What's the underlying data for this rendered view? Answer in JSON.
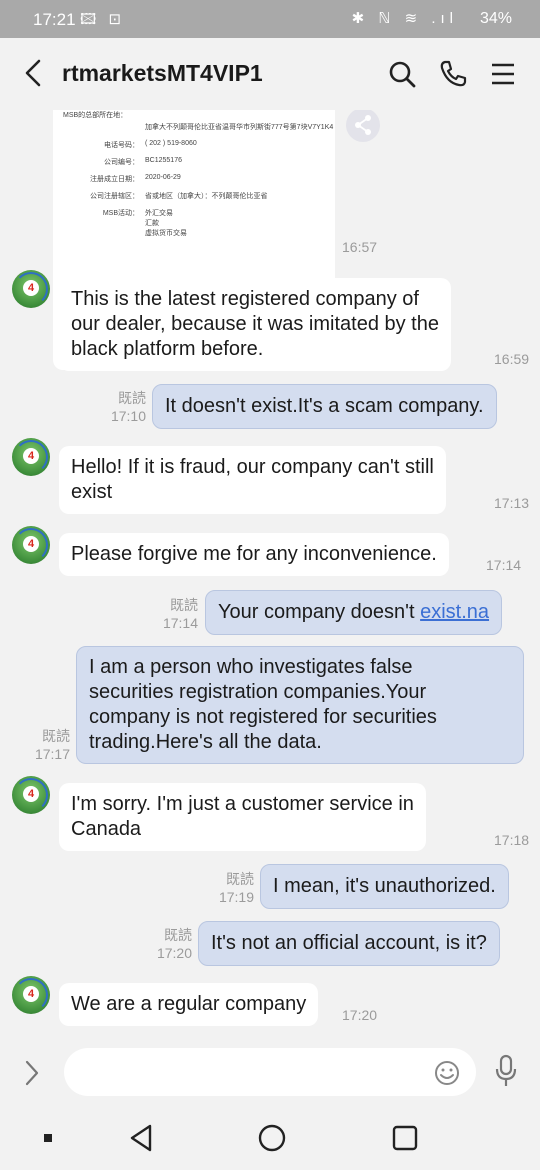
{
  "status_bar": {
    "time": "17:21",
    "left_icons": "🖾 ⊡",
    "right_icons": "✱ ℕ ≋ .ıl",
    "battery": "34%"
  },
  "header": {
    "title": "rtmarketsMT4VIP1",
    "icons": [
      "back-arrow-icon",
      "search-icon",
      "phone-icon",
      "menu-icon"
    ]
  },
  "image_message": {
    "rows": [
      {
        "key": "MSB的总部所在地：",
        "value": "加拿大不列颠哥伦比亚省温哥华市列斯街777号第7块V7Y1K4"
      },
      {
        "key": "电话号码：",
        "value": "( 202 ) 519-8060"
      },
      {
        "key": "公司编号：",
        "value": "BC1255176"
      },
      {
        "key": "注册成立日期：",
        "value": "2020-06-29"
      },
      {
        "key": "公司注册辖区：",
        "value": "省或地区（加拿大）：不列颠哥伦比亚省"
      },
      {
        "key": "MSB活动：",
        "value": "外汇交易"
      },
      {
        "key": "",
        "value": "汇款"
      },
      {
        "key": "",
        "value": "虚拟货币交易"
      }
    ],
    "time": "16:57"
  },
  "messages": [
    {
      "dir": "in",
      "lines": [
        "This is the latest registered company of",
        "our dealer, because it was imitated by the",
        "black platform before."
      ],
      "time": "16:59"
    },
    {
      "dir": "out",
      "read": "既読",
      "lines": [
        "It doesn't exist.It's a scam company."
      ],
      "time": "17:10"
    },
    {
      "dir": "in",
      "lines": [
        "Hello! If it is fraud, our company can't still",
        "exist"
      ],
      "time": "17:13"
    },
    {
      "dir": "in",
      "lines": [
        "Please forgive me for any inconvenience."
      ],
      "time": "17:14"
    },
    {
      "dir": "out",
      "read": "既読",
      "prefix": "Your company doesn't ",
      "link": "exist.na",
      "time": "17:14"
    },
    {
      "dir": "out",
      "read": "既読",
      "lines": [
        "I am a person who investigates false",
        "securities registration companies.Your",
        "company is not registered for securities",
        "trading.Here's all the data."
      ],
      "time": "17:17"
    },
    {
      "dir": "in",
      "lines": [
        "I'm sorry. I'm just a customer service in",
        "Canada"
      ],
      "time": "17:18"
    },
    {
      "dir": "out",
      "read": "既読",
      "lines": [
        "I mean, it's unauthorized."
      ],
      "time": "17:19"
    },
    {
      "dir": "out",
      "read": "既読",
      "lines": [
        "It's not an official account, is it?"
      ],
      "time": "17:20"
    },
    {
      "dir": "in",
      "lines": [
        "We are a regular company"
      ],
      "time": "17:20"
    }
  ],
  "avatar_badge": "4",
  "input": {
    "placeholder": "",
    "icons": [
      "expand-icon",
      "emoji-icon",
      "microphone-icon"
    ]
  },
  "nav_bar": {
    "icons": [
      "recents-dot-icon",
      "back-triangle-icon",
      "home-circle-icon",
      "overview-square-icon"
    ]
  }
}
